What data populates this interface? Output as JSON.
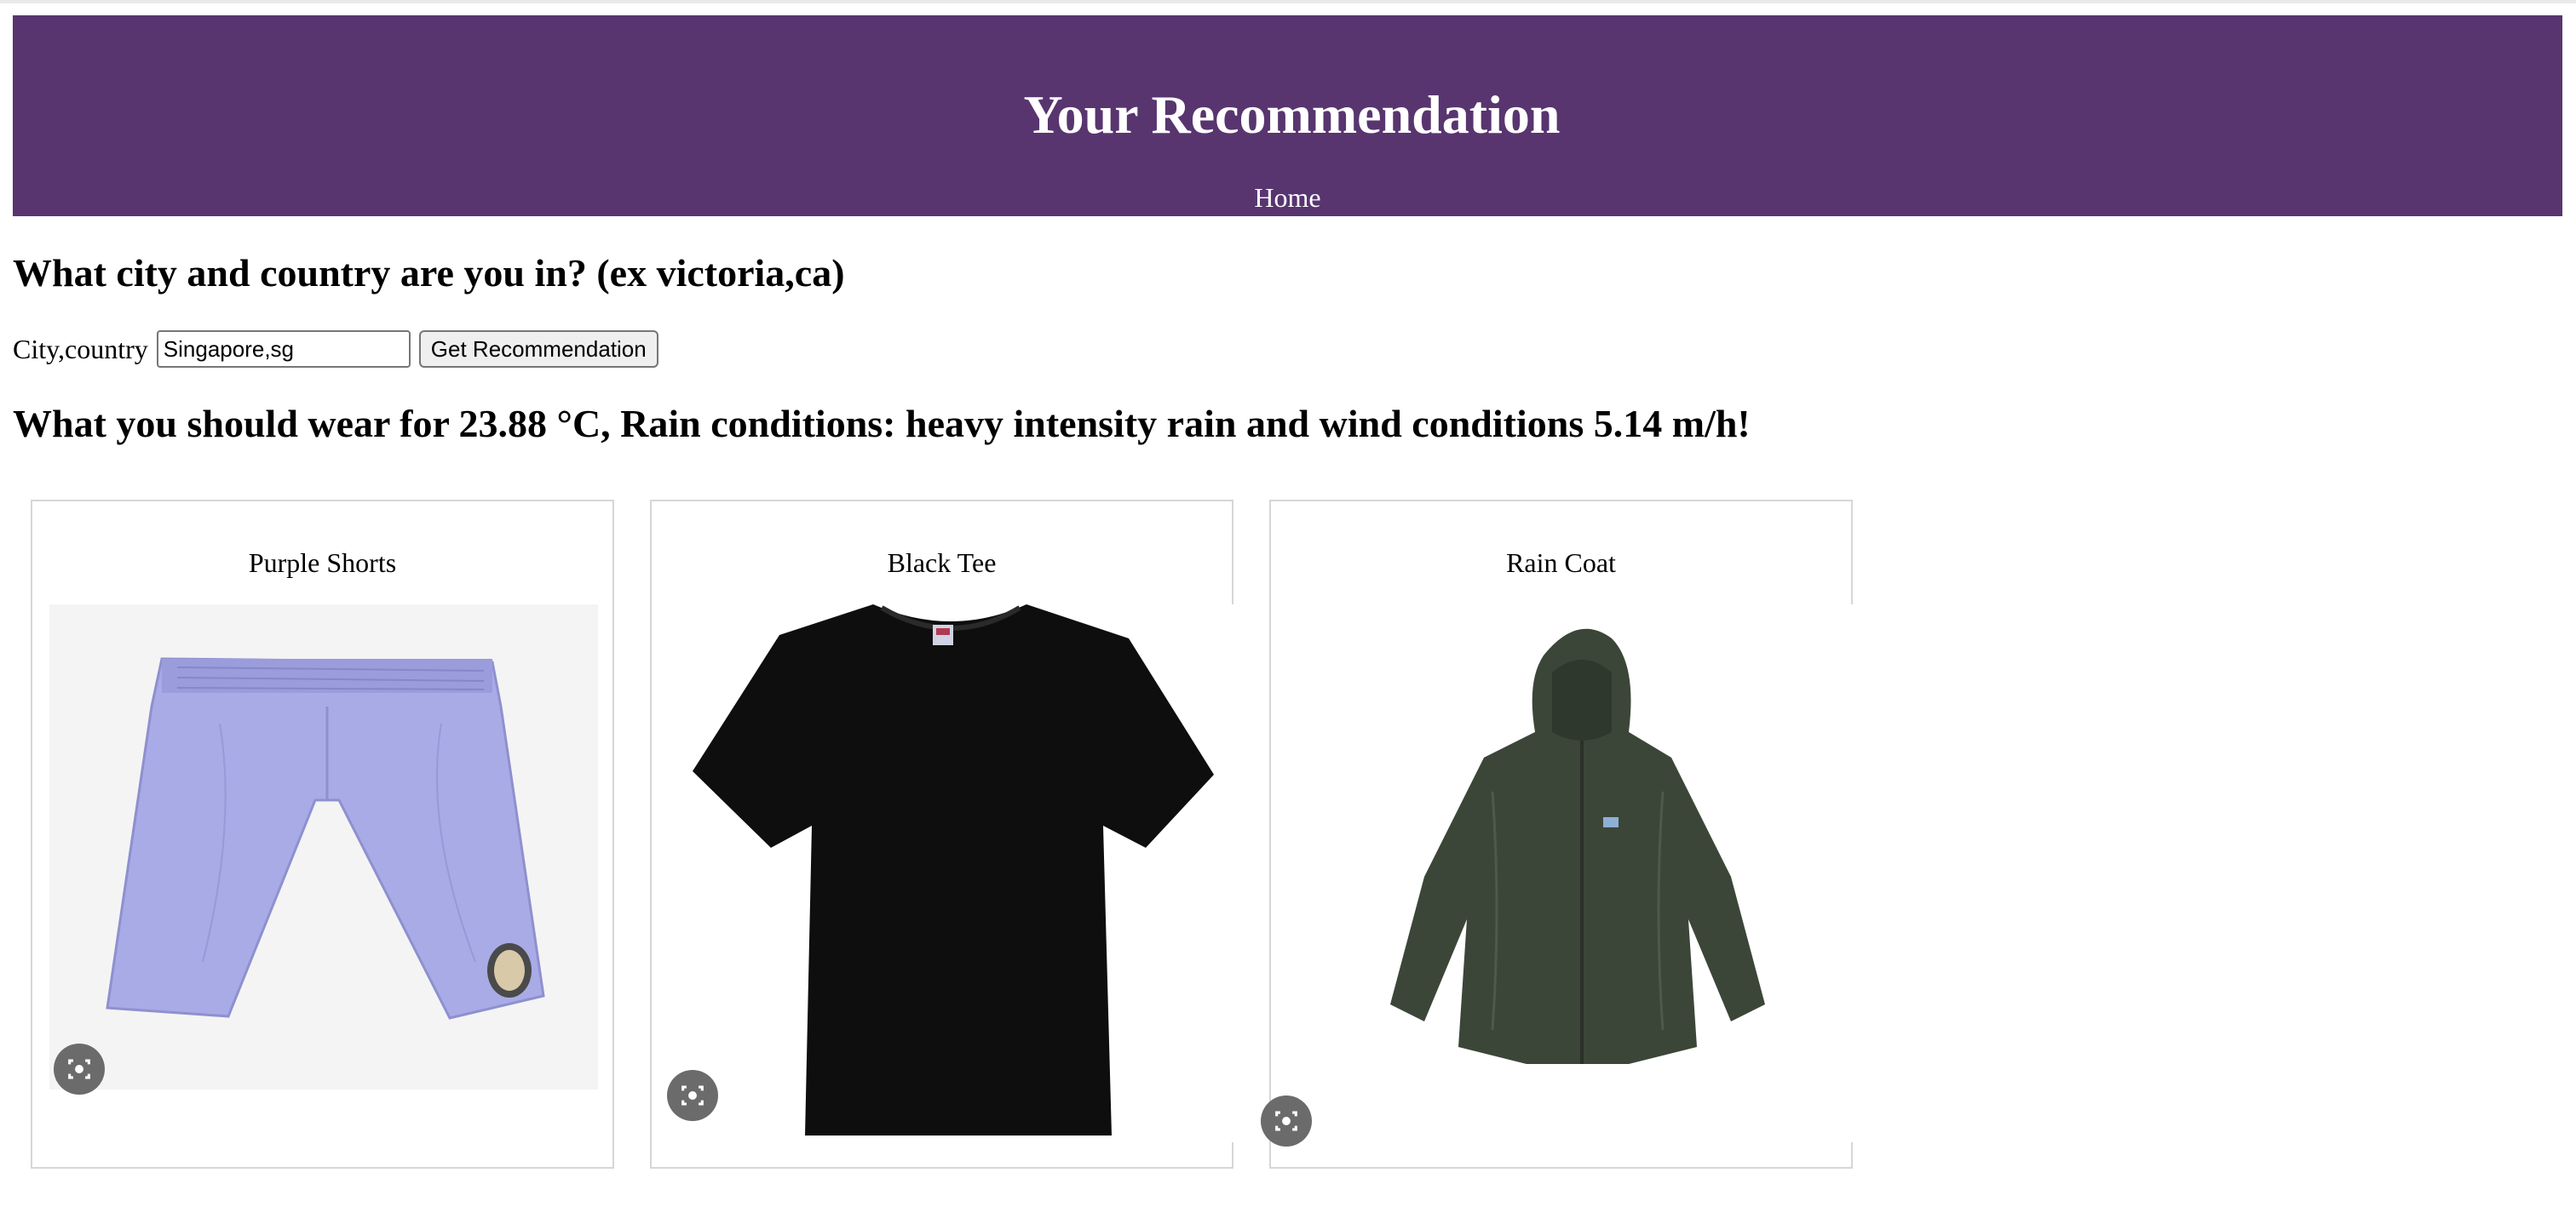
{
  "header": {
    "title": "Your Recommendation",
    "nav": {
      "home_label": "Home"
    }
  },
  "form": {
    "question": "What city and country are you in? (ex victoria,ca)",
    "field_label": "City,country",
    "city_value": "Singapore,sg",
    "submit_label": "Get Recommendation"
  },
  "weather": {
    "heading": "What you should wear for 23.88 °C, Rain conditions: heavy intensity rain and wind conditions 5.14 m/h!"
  },
  "recommendations": [
    {
      "name": "Purple Shorts",
      "icon": "shorts-image",
      "color": "#a9abe6"
    },
    {
      "name": "Black Tee",
      "icon": "tshirt-image",
      "color": "#0e0e0e"
    },
    {
      "name": "Rain Coat",
      "icon": "raincoat-image",
      "color": "#3b4638"
    }
  ],
  "colors": {
    "banner": "#58356f",
    "card_border": "#d6d6d6"
  }
}
